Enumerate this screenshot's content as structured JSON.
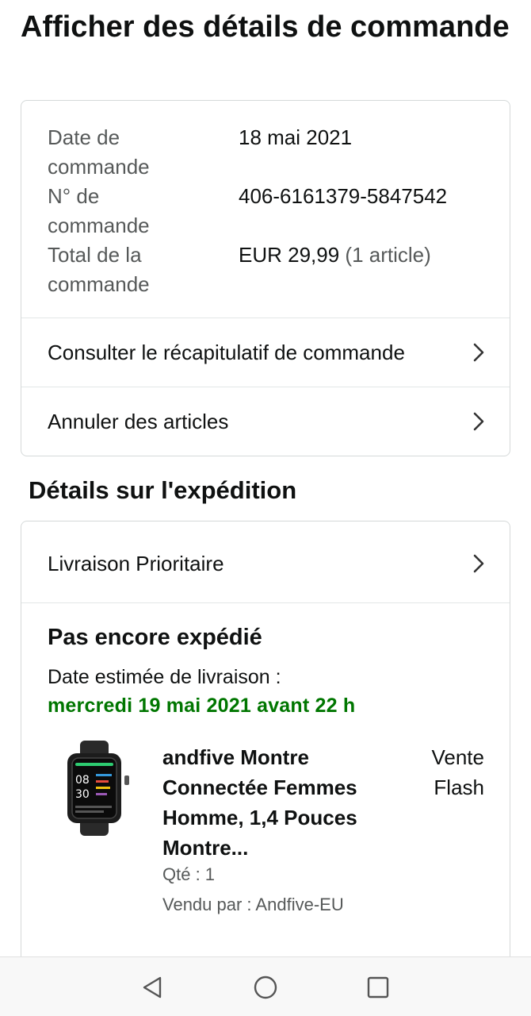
{
  "page_title": "Afficher des détails de commande",
  "order_info": {
    "date_label": "Date de commande",
    "date_value": "18 mai 2021",
    "number_label": "N° de commande",
    "number_value": "406-6161379-5847542",
    "total_label": "Total de la commande",
    "total_value": "EUR 29,99",
    "total_items": "(1 article)"
  },
  "links": {
    "summary": "Consulter le récapitulatif de commande",
    "cancel": "Annuler des articles",
    "delivery": "Livraison Prioritaire"
  },
  "shipping": {
    "section_title": "Détails sur l'expédition",
    "status": "Pas encore expédié",
    "estimate_label": "Date estimée de livraison :",
    "estimate_date": "mercredi 19 mai 2021 avant 22 h"
  },
  "product": {
    "title": "andfive Montre Connectée Femmes Homme, 1,4 Pouces Montre...",
    "quantity": "Qté : 1",
    "seller": "Vendu par : Andfive-EU",
    "badge": "Vente Flash"
  },
  "colors": {
    "delivery_green": "#007600",
    "border": "#d5d9d9",
    "secondary_text": "#565959"
  },
  "icons": [
    "chevron-right-icon",
    "nav-back-icon",
    "nav-home-icon",
    "nav-recents-icon"
  ]
}
